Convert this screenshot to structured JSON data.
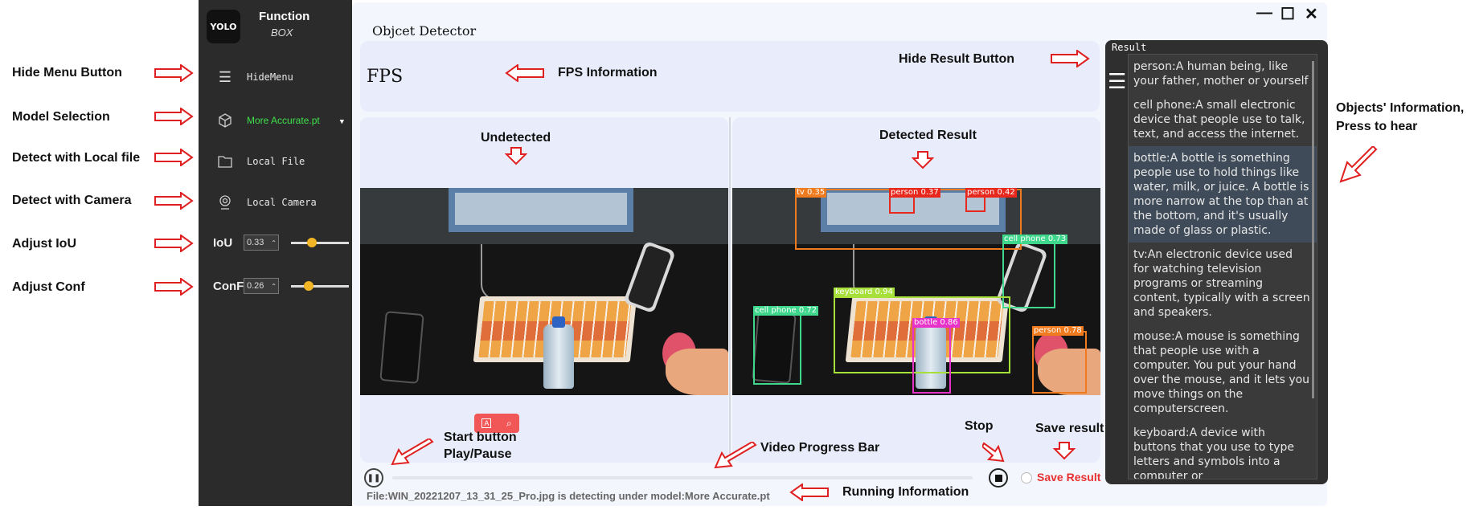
{
  "annotations_left": [
    {
      "label": "Hide Menu Button"
    },
    {
      "label": "Model Selection"
    },
    {
      "label": "Detect with Local file"
    },
    {
      "label": "Detect with Camera"
    },
    {
      "label": "Adjust IoU"
    },
    {
      "label": "Adjust Conf"
    }
  ],
  "annotations_mid": {
    "fps_info": "FPS Information",
    "hide_result_button": "Hide Result Button",
    "undetected": "Undetected",
    "detected_result": "Detected Result",
    "start_button": "Start button",
    "play_pause": "Play/Pause",
    "video_progress": "Video Progress Bar",
    "stop": "Stop",
    "save_result": "Save result",
    "running_info": "Running Information"
  },
  "annotations_right": {
    "line1": "Objects' Information,",
    "line2": "Press to hear"
  },
  "sidebar": {
    "logo_text": "YOLO",
    "title": "Function",
    "subtitle": "BOX",
    "hide_menu_label": "HideMenu",
    "model_label": "More Accurate.pt",
    "local_file_label": "Local File",
    "local_camera_label": "Local Camera",
    "iou_label": "IoU",
    "iou_value": "0.33",
    "conf_label": "ConF",
    "conf_value": "0.26",
    "iou_level": 0.33,
    "conf_level": 0.26
  },
  "window": {
    "title": "Objcet Detector",
    "fps_label": "FPS",
    "minimize": "—",
    "maximize": "☐",
    "close": "✕"
  },
  "detections": [
    {
      "label": "tv 0.35",
      "color": "#f07a1e"
    },
    {
      "label": "person 0.37",
      "color": "#e8281c"
    },
    {
      "label": "person 0.42",
      "color": "#e8281c"
    },
    {
      "label": "cell phone 0.73",
      "color": "#3fd78b"
    },
    {
      "label": "keyboard 0.94",
      "color": "#a8e03b"
    },
    {
      "label": "cell phone 0.72",
      "color": "#3fd78b"
    },
    {
      "label": "bottle 0.86",
      "color": "#e733c9"
    },
    {
      "label": "person 0.78",
      "color": "#f07a1e"
    }
  ],
  "controls": {
    "save_result_label": "Save Result",
    "running_info": "File:WIN_20221207_13_31_25_Pro.jpg is detecting under model:More Accurate.pt",
    "progress": 0
  },
  "result_panel": {
    "title": "Result",
    "items": [
      {
        "text": "person:A human being, like your father, mother or yourself"
      },
      {
        "text": "cell phone:A small electronic device that people use to talk, text, and access the internet."
      },
      {
        "text": "bottle:A bottle is something people use to hold things like water, milk, or juice. A bottle is more narrow at the top than at the bottom, and it's usually made of glass or plastic."
      },
      {
        "text": "tv:An electronic device used for watching television programs or streaming content, typically with a screen and speakers."
      },
      {
        "text": "mouse:A mouse is something that people use with a computer. You put your hand over the mouse, and it lets you move things on the computerscreen."
      },
      {
        "text": "keyboard:A device with buttons that you use to type letters and symbols into a computer or"
      }
    ]
  }
}
